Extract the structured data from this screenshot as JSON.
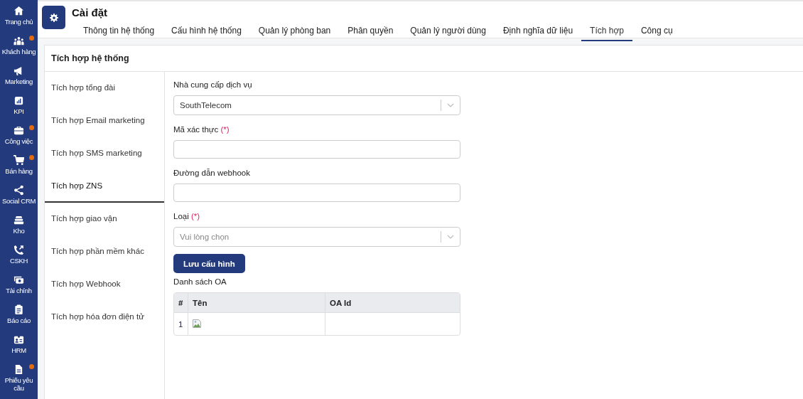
{
  "sidebar": {
    "items": [
      {
        "label": "Trang chủ",
        "badge": false
      },
      {
        "label": "Khách hàng",
        "badge": true
      },
      {
        "label": "Marketing",
        "badge": false
      },
      {
        "label": "KPI",
        "badge": false
      },
      {
        "label": "Công việc",
        "badge": true
      },
      {
        "label": "Bán hàng",
        "badge": true
      },
      {
        "label": "Social CRM",
        "badge": false
      },
      {
        "label": "Kho",
        "badge": false
      },
      {
        "label": "CSKH",
        "badge": false
      },
      {
        "label": "Tài chính",
        "badge": false
      },
      {
        "label": "Báo cáo",
        "badge": false
      },
      {
        "label": "HRM",
        "badge": false
      },
      {
        "label": "Phiếu yêu cầu",
        "badge": true
      }
    ]
  },
  "header": {
    "title": "Cài đặt",
    "tabs": [
      {
        "label": "Thông tin hệ thống",
        "selected": false
      },
      {
        "label": "Cấu hình hệ thống",
        "selected": false
      },
      {
        "label": "Quản lý phòng ban",
        "selected": false
      },
      {
        "label": "Phân quyền",
        "selected": false
      },
      {
        "label": "Quản lý người dùng",
        "selected": false
      },
      {
        "label": "Định nghĩa dữ liệu",
        "selected": false
      },
      {
        "label": "Tích hợp",
        "selected": true
      },
      {
        "label": "Công cụ",
        "selected": false
      }
    ]
  },
  "panel": {
    "title": "Tích hợp hệ thống",
    "menu": [
      {
        "label": "Tích hợp tổng đài",
        "selected": false
      },
      {
        "label": "Tích hợp Email marketing",
        "selected": false
      },
      {
        "label": "Tích hợp SMS marketing",
        "selected": false
      },
      {
        "label": "Tích hợp ZNS",
        "selected": true
      },
      {
        "label": "Tích hợp giao vận",
        "selected": false
      },
      {
        "label": "Tích hợp phần mềm khác",
        "selected": false
      },
      {
        "label": "Tích hợp Webhook",
        "selected": false
      },
      {
        "label": "Tích hợp hóa đơn điện tử",
        "selected": false
      }
    ],
    "form": {
      "fields": [
        {
          "kind": "select",
          "label": "Nhà cung cấp dịch vụ",
          "value": "SouthTelecom"
        },
        {
          "kind": "input",
          "label": "Mã xác thực",
          "required_mark": "(*)"
        },
        {
          "kind": "input",
          "label": "Đường dẫn webhook"
        },
        {
          "kind": "select",
          "label": "Loại",
          "required_mark": "(*)",
          "placeholder": "Vui lòng chọn"
        }
      ],
      "save_button": "Lưu cấu hình",
      "table": {
        "title": "Danh sách OA",
        "columns": [
          "#",
          "Tên",
          "OA Id"
        ],
        "rows": [
          {
            "cells": [
              "1",
              {
                "kind": "picture"
              },
              ""
            ]
          }
        ]
      }
    }
  }
}
